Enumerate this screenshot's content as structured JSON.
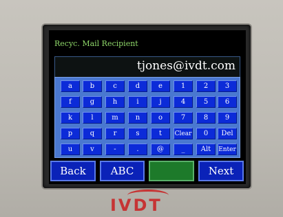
{
  "title": "Recyc. Mail Recipient",
  "email": "tjones@ivdt.com",
  "keyboard": {
    "rows": [
      [
        "a",
        "b",
        "c",
        "d",
        "e",
        "1",
        "2",
        "3"
      ],
      [
        "f",
        "g",
        "h",
        "i",
        "j",
        "4",
        "5",
        "6"
      ],
      [
        "k",
        "l",
        "m",
        "n",
        "o",
        "7",
        "8",
        "9"
      ],
      [
        "p",
        "q",
        "r",
        "s",
        "t",
        "Clear",
        "0",
        "Del"
      ],
      [
        "u",
        "v",
        "-",
        ".",
        "@",
        "_",
        "Alt",
        "Enter"
      ]
    ]
  },
  "buttons": {
    "back": "Back",
    "abc": "ABC",
    "next": "Next"
  },
  "brand": {
    "name": "IVDT",
    "color": "#c63434"
  }
}
